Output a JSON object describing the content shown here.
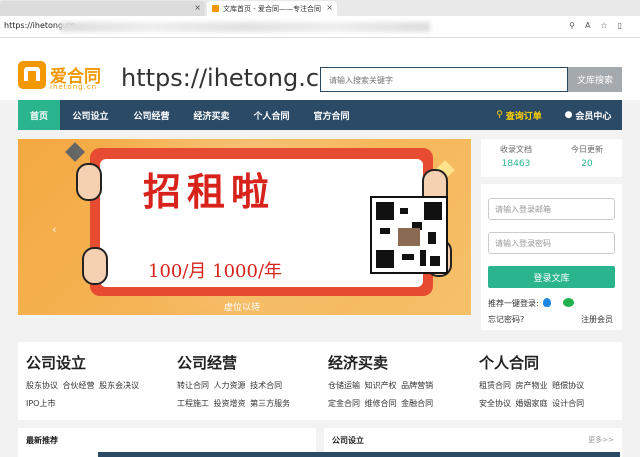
{
  "browser": {
    "tabs": [
      {
        "label": "",
        "active": false
      },
      {
        "label": "文库首页 - 爱合同——专注合同",
        "active": true
      }
    ],
    "url": "https://ihetong.cn"
  },
  "header": {
    "logo_cn": "爱合同",
    "logo_en": "ihetong.cn",
    "domain": "https://ihetong.cn/",
    "search_placeholder": "请输入搜索关键字",
    "search_button": "文库搜索"
  },
  "nav": {
    "items": [
      "首页",
      "公司设立",
      "公司经营",
      "经济买卖",
      "个人合同",
      "官方合同"
    ],
    "active_index": 0,
    "query_order": "查询订单",
    "member_center": "会员中心"
  },
  "banner": {
    "headline": "招租啦",
    "price": "100/月 1000/年",
    "caption": "虚位以待"
  },
  "stats": {
    "docs_label": "收录文档",
    "docs_value": "18463",
    "today_label": "今日更新",
    "today_value": "20"
  },
  "login": {
    "email_placeholder": "请输入登录邮箱",
    "password_placeholder": "请输入登录密码",
    "login_button": "登录文库",
    "one_click": "推荐一键登录:",
    "forgot": "忘记密码?",
    "register": "注册会员"
  },
  "categories": [
    {
      "title": "公司设立",
      "rows": [
        "股东协议 合伙经营 股东会决议",
        "IPO上市"
      ]
    },
    {
      "title": "公司经营",
      "rows": [
        "转让合同 人力资源 技术合同",
        "工程施工 投资增资 第三方服务"
      ]
    },
    {
      "title": "经济买卖",
      "rows": [
        "仓储运输 知识产权 品牌营销",
        "定金合同 维修合同 金融合同"
      ]
    },
    {
      "title": "个人合同",
      "rows": [
        "租赁合同 房产物业 赔偿协议",
        "安全协议 婚姻家庭 设计合同"
      ]
    }
  ],
  "bottom": {
    "left_title": "最新推荐",
    "right_title": "公司设立",
    "more": "更多>>"
  },
  "colors": {
    "nav": "#2a4a66",
    "accent": "#2bb58f",
    "brand": "#f39800",
    "gold": "#ffd200"
  }
}
